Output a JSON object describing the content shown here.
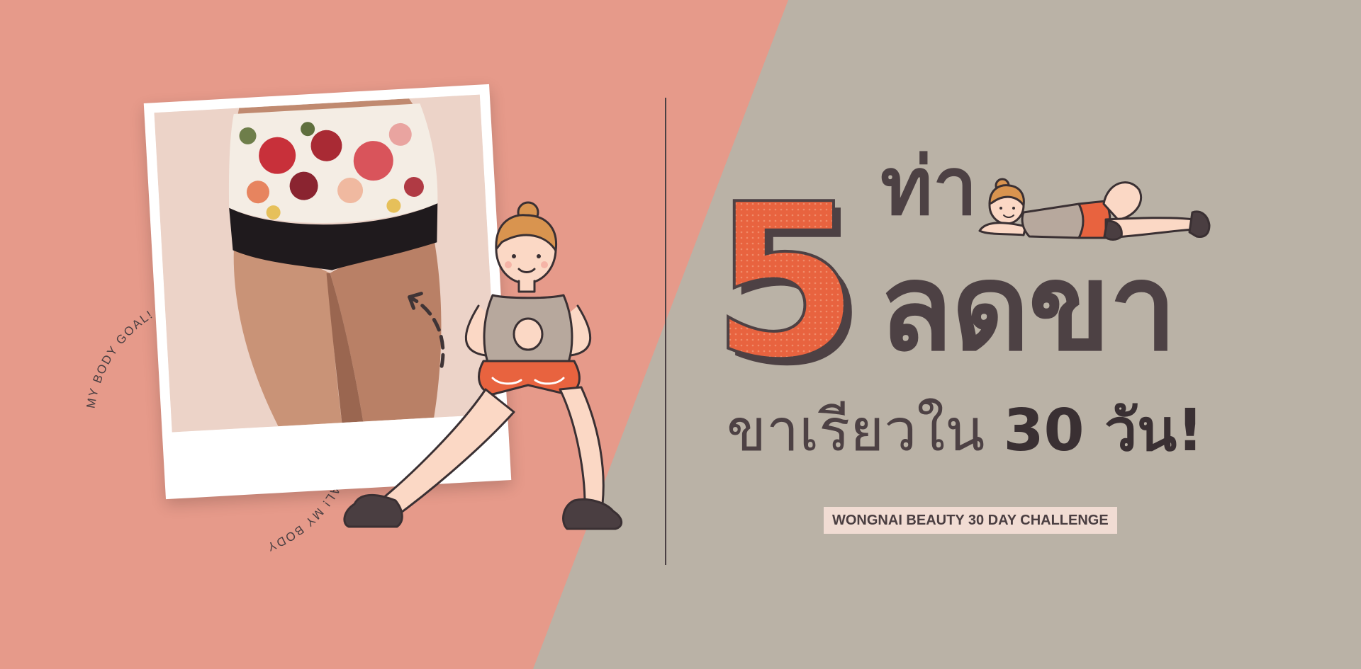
{
  "banner": {
    "headline_number": "5",
    "headline_line1": "ท่า",
    "headline_line2": "ลดขา",
    "subline_regular": "ขาเรียวใน",
    "subline_bold": "30 วัน!",
    "badge": "WONGNAI BEAUTY 30 DAY CHALLENGE",
    "circular_text": "MY BODY GOAL! MY BODY GOAL! MY BODY GOAL! MY BODY GOAL! MY BODY",
    "icons": {
      "photo": "thighs-photo",
      "arrow": "dashed-arrow-icon",
      "squat": "squatting-woman-illustration",
      "lying": "lying-woman-illustration"
    }
  },
  "colors": {
    "salmon": "#e69a8a",
    "grey": "#bab2a6",
    "orange": "#e8633f",
    "dark": "#4d4144",
    "badge_bg": "#f1dcd3"
  }
}
